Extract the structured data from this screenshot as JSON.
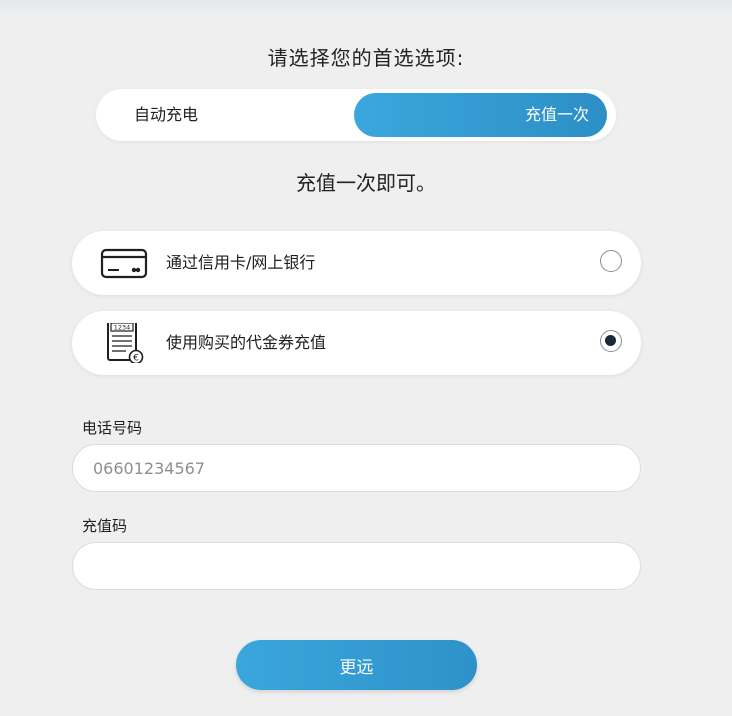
{
  "heading": "请选择您的首选选项:",
  "mode_toggle": {
    "options": [
      "自动充电",
      "充值一次"
    ],
    "selected": "充值一次"
  },
  "subheading": "充值一次即可。",
  "payment_methods": [
    {
      "label": "通过信用卡/网上银行",
      "icon": "credit-card-icon",
      "selected": false
    },
    {
      "label": "使用购买的代金券充值",
      "icon": "voucher-receipt-icon",
      "selected": true
    }
  ],
  "voucher_icon_text": {
    "number": "1234",
    "currency": "€"
  },
  "form": {
    "phone": {
      "label": "电话号码",
      "value": "",
      "placeholder": "06601234567"
    },
    "code": {
      "label": "充值码",
      "value": "",
      "placeholder": ""
    }
  },
  "submit_label": "更远",
  "colors": {
    "accent": "#3aa6db",
    "background": "#efeff0",
    "radio_fill": "#1b2a3a"
  }
}
